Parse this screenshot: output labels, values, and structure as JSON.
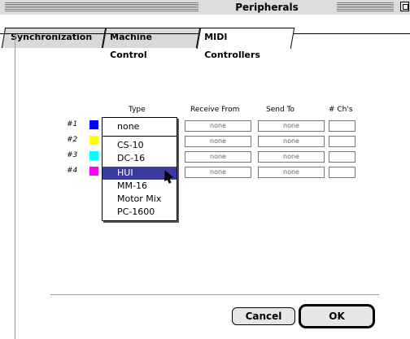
{
  "window": {
    "title": "Peripherals"
  },
  "tabs": [
    {
      "label": "Synchronization",
      "active": false
    },
    {
      "label": "Machine Control",
      "active": false
    },
    {
      "label": "MIDI Controllers",
      "active": true
    }
  ],
  "columns": {
    "type": "Type",
    "receive_from": "Receive From",
    "send_to": "Send To",
    "channels": "# Ch's"
  },
  "rows": [
    {
      "num": "#1",
      "color": "#0000ff",
      "receive_from": "none",
      "send_to": "none",
      "channels": ""
    },
    {
      "num": "#2",
      "color": "#ffff00",
      "receive_from": "none",
      "send_to": "none",
      "channels": ""
    },
    {
      "num": "#3",
      "color": "#00ffff",
      "receive_from": "none",
      "send_to": "none",
      "channels": ""
    },
    {
      "num": "#4",
      "color": "#ff00ff",
      "receive_from": "none",
      "send_to": "none",
      "channels": ""
    }
  ],
  "type_menu": {
    "items": [
      "none",
      "CS-10",
      "DC-16",
      "HUI",
      "MM-16",
      "Motor Mix",
      "PC-1600"
    ],
    "highlighted": "HUI"
  },
  "buttons": {
    "cancel": "Cancel",
    "ok": "OK"
  },
  "colors": {
    "highlight": "#3a3aa0",
    "tab_inactive": "#d9d9d9"
  }
}
